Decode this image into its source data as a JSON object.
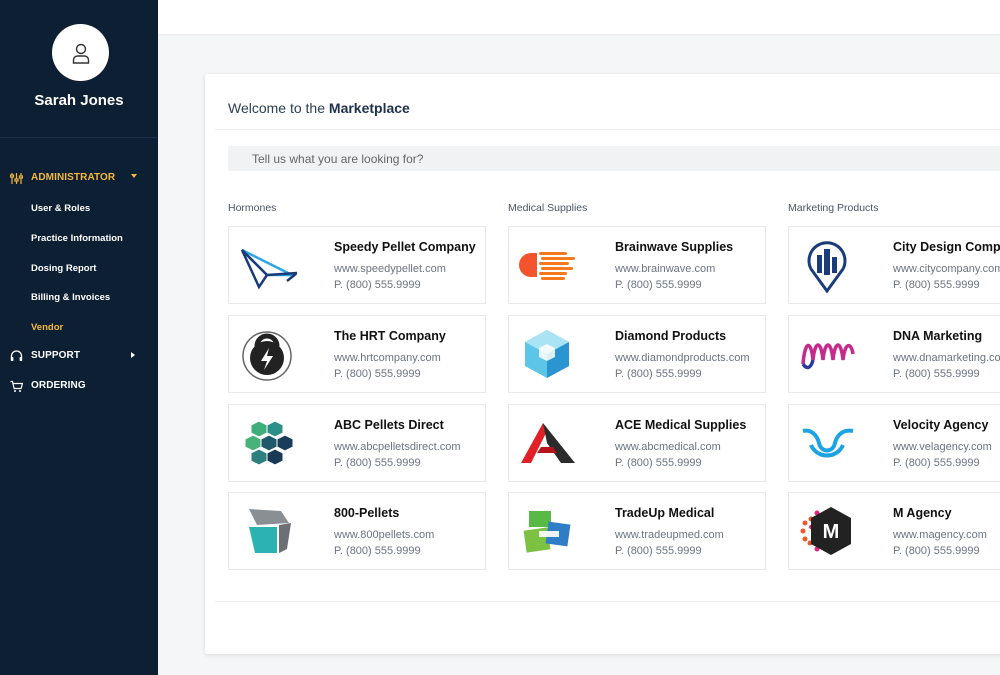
{
  "user": {
    "name": "Sarah Jones"
  },
  "sidebar": {
    "sections": [
      {
        "label": "ADMINISTRATOR",
        "icon": "sliders-icon"
      },
      {
        "label": "SUPPORT",
        "icon": "headset-icon"
      },
      {
        "label": "ORDERING",
        "icon": "cart-icon"
      }
    ],
    "admin_items": [
      {
        "label": "User & Roles"
      },
      {
        "label": "Practice Information"
      },
      {
        "label": "Dosing Report"
      },
      {
        "label": "Billing & Invoices"
      },
      {
        "label": "Vendor"
      }
    ],
    "accent": "#f5b83d",
    "background": "#0d1f33"
  },
  "marketplace": {
    "welcome_prefix": "Welcome to the",
    "welcome_strong": "Marketplace",
    "search_placeholder": "Tell us what you are looking for?",
    "columns": [
      {
        "title": "Hormones",
        "vendors": [
          {
            "name": "Speedy Pellet Company",
            "url": "www.speedypellet.com",
            "phone": "P. (800) 555.9999",
            "logo": "paper-plane-logo"
          },
          {
            "name": "The HRT Company",
            "url": "www.hrtcompany.com",
            "phone": "P. (800) 555.9999",
            "logo": "kettlebell-bolt-logo"
          },
          {
            "name": "ABC Pellets Direct",
            "url": "www.abcpelletsdirect.com",
            "phone": "P. (800) 555.9999",
            "logo": "hexagon-head-logo"
          },
          {
            "name": "800-Pellets",
            "url": "www.800pellets.com",
            "phone": "P. (800) 555.9999",
            "logo": "folded-shape-logo"
          }
        ]
      },
      {
        "title": "Medical Supplies",
        "vendors": [
          {
            "name": "Brainwave Supplies",
            "url": "www.brainwave.com",
            "phone": "P. (800) 555.9999",
            "logo": "brainwave-logo"
          },
          {
            "name": "Diamond Products",
            "url": "www.diamondproducts.com",
            "phone": "P. (800) 555.9999",
            "logo": "hexagon-cube-logo"
          },
          {
            "name": "ACE Medical Supplies",
            "url": "www.abcmedical.com",
            "phone": "P. (800) 555.9999",
            "logo": "letter-a-logo"
          },
          {
            "name": "TradeUp Medical",
            "url": "www.tradeupmed.com",
            "phone": "P. (800) 555.9999",
            "logo": "handshake-logo"
          }
        ]
      },
      {
        "title": "Marketing Products",
        "vendors": [
          {
            "name": "City Design Company",
            "url": "www.citycompany.com",
            "phone": "P. (800) 555.9999",
            "logo": "city-pin-logo"
          },
          {
            "name": "DNA Marketing",
            "url": "www.dnamarketing.com",
            "phone": "P. (800) 555.9999",
            "logo": "wave-loops-logo"
          },
          {
            "name": "Velocity Agency",
            "url": "www.velagency.com",
            "phone": "P. (800) 555.9999",
            "logo": "wings-logo"
          },
          {
            "name": "M Agency",
            "url": "www.magency.com",
            "phone": "P. (800) 555.9999",
            "logo": "m-hexagon-logo"
          }
        ]
      }
    ]
  }
}
